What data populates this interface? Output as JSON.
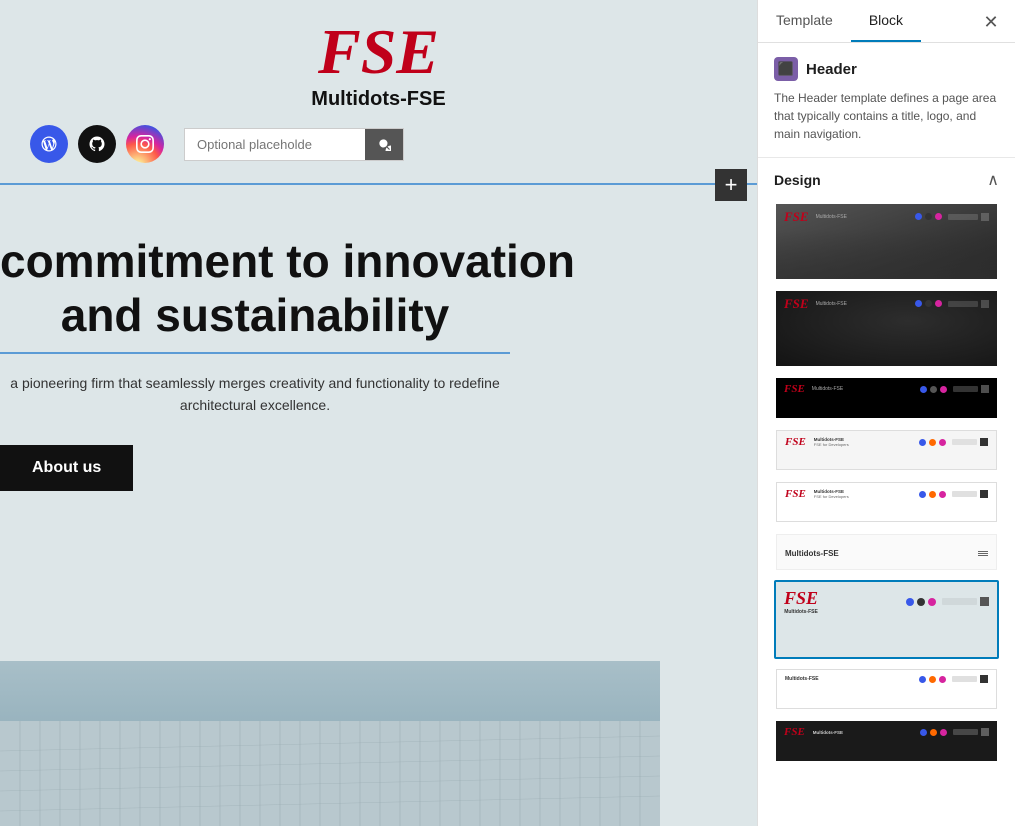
{
  "left": {
    "logo": "FSE",
    "site_title": "Multidots-FSE",
    "search_placeholder": "Optional placeholde",
    "hero_line1": "commitment to innovation",
    "hero_line2": "and sustainability",
    "hero_desc": "a pioneering firm that seamlessly merges creativity and functionality to redefine architectural excellence.",
    "about_btn": "About us",
    "add_btn": "+"
  },
  "right": {
    "tabs": [
      {
        "label": "Template",
        "active": false
      },
      {
        "label": "Block",
        "active": true
      }
    ],
    "block_name": "Header",
    "block_desc": "The Header template defines a page area that typically contains a title, logo, and main navigation.",
    "design_label": "Design",
    "templates": [
      {
        "id": 1,
        "type": "dark_fog",
        "selected": false
      },
      {
        "id": 2,
        "type": "dark_fog2",
        "selected": false
      },
      {
        "id": 3,
        "type": "black_bar",
        "selected": false
      },
      {
        "id": 4,
        "type": "white_fse",
        "selected": false
      },
      {
        "id": 5,
        "type": "white_fse2",
        "selected": false
      },
      {
        "id": 6,
        "type": "minimal",
        "selected": false
      },
      {
        "id": 7,
        "type": "selected_current",
        "selected": true
      },
      {
        "id": 8,
        "type": "white_fse3",
        "selected": false
      },
      {
        "id": 9,
        "type": "dark_fse_footer",
        "selected": false
      }
    ]
  }
}
